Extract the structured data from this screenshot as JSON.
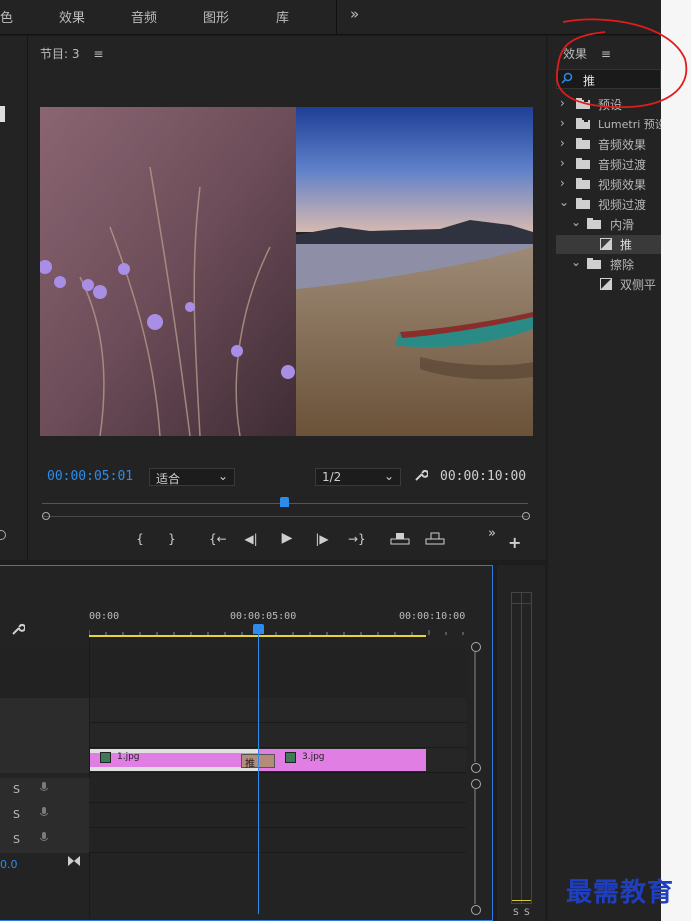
{
  "top_menu": {
    "items": [
      "色",
      "效果",
      "音频",
      "图形",
      "库"
    ],
    "more": "»"
  },
  "program": {
    "title": "节目: 3",
    "menu_icon": "≡",
    "current_time": "00:00:05:01",
    "fit_select": "适合",
    "resolution_select": "1/2",
    "duration": "00:00:10:00",
    "playhead_fraction": 0.5,
    "controls": {
      "mark_in": "{",
      "mark_out": "}",
      "go_to_in": "{←",
      "step_back": "◀|",
      "play": "▶",
      "step_forward": "|▶",
      "go_to_out": "→}",
      "lift": "lift",
      "extract": "extract",
      "more": "»",
      "add": "+"
    }
  },
  "effects_panel": {
    "title": "效果",
    "menu_icon": "≡",
    "search_value": "推",
    "tree": [
      {
        "label": "预设",
        "type": "folder-special",
        "depth": 0,
        "expanded": false
      },
      {
        "label": "Lumetri 预设",
        "type": "folder-special",
        "depth": 0,
        "expanded": false
      },
      {
        "label": "音频效果",
        "type": "folder",
        "depth": 0,
        "expanded": false
      },
      {
        "label": "音频过渡",
        "type": "folder",
        "depth": 0,
        "expanded": false
      },
      {
        "label": "视频效果",
        "type": "folder",
        "depth": 0,
        "expanded": false
      },
      {
        "label": "视频过渡",
        "type": "folder",
        "depth": 0,
        "expanded": true
      },
      {
        "label": "内滑",
        "type": "folder",
        "depth": 1,
        "expanded": true
      },
      {
        "label": "推",
        "type": "effect",
        "depth": 2,
        "selected": true
      },
      {
        "label": "擦除",
        "type": "folder",
        "depth": 1,
        "expanded": true
      },
      {
        "label": "双侧平",
        "type": "effect",
        "depth": 2,
        "selected": false
      }
    ]
  },
  "timeline": {
    "ruler": [
      "00:00",
      "00:00:05:00",
      "00:00:10:00"
    ],
    "clips": [
      {
        "name": "1.jpg"
      },
      {
        "name": "3.jpg"
      }
    ],
    "transition_label": "推",
    "audio_tracks": [
      {
        "solo": "S"
      },
      {
        "solo": "S"
      },
      {
        "solo": "S"
      }
    ],
    "master_value": "0.0",
    "meter_labels": [
      "S",
      "S"
    ]
  },
  "watermark": "最需教育"
}
